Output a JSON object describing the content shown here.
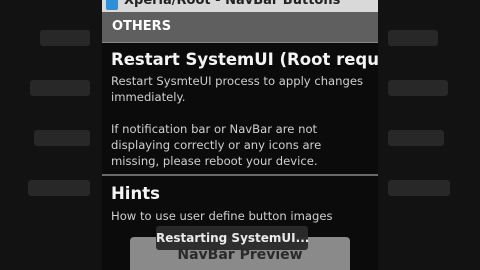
{
  "app": {
    "title": "Xperia/Root - NavBar Buttons",
    "icon": "app-icon"
  },
  "section": {
    "header": "OTHERS"
  },
  "prefs": [
    {
      "title": "Restart SystemUI (Root required)",
      "summary_line1": "Restart SysmteUI process to apply changes immediately.",
      "summary_line2": "If notification bar or NavBar are not displaying correctly or any icons are missing, please reboot your device."
    },
    {
      "title": "Hints",
      "summary": "How to use user define button images"
    }
  ],
  "preview_button": {
    "label": "NavBar Preview"
  },
  "toast": {
    "text": "Restarting SystemUI..."
  },
  "colors": {
    "section_header_bg": "#5f5f5f",
    "app_icon": "#2f8fd8",
    "background": "#0b0b0b"
  }
}
